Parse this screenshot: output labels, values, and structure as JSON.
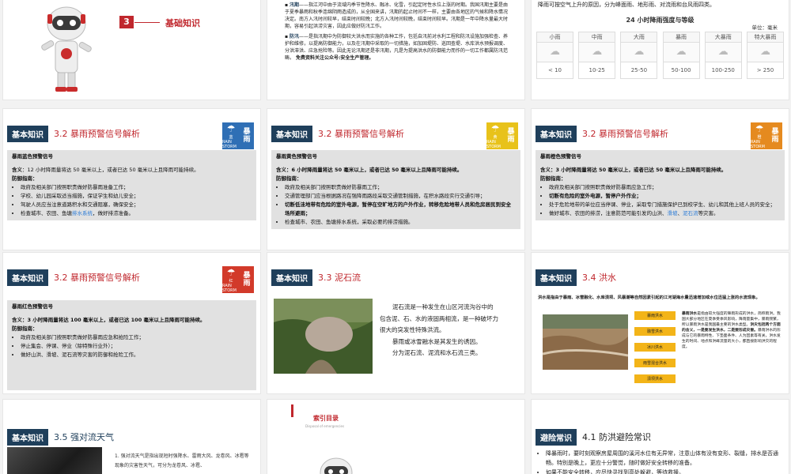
{
  "slide1": {
    "num": "3",
    "title": "基础知识"
  },
  "slide2": {
    "p1_head": "汛期",
    "p1_text": "——指江河中由于流域内季节性降水、融冰、化雪，引起定时性水位上涨的时期。我国汛期主要是由于夏季暴雨和秋季连绵阴雨造成的，从全国来讲，汛期的起止时间不一样，主要由各地区的气候和降水情况决定。南方入汛时间较早，结束时间较晚；北方入汛时间较晚，结束时间较早。汛期是一年中降水量最大时期，容易引起洪涝灾害，因此应做好防汛工作。",
    "p2_head": "防汛",
    "p2_text": "——是指汛期中为防御较大洪水而实施的各种工作，包括自汛前对水利工程和防汛设施加强检查、养护和维修，以提高防御能力，以及在汛期中采取的一切措施，如加固堤防、巡回查堤、水库洪水预报调度、分洪滞洪、应急抢险等。因此无论汛期还是非汛期，凡是为提高洪水的防御能力而作的一切工作都属防汛范畴。",
    "p2_end": "免费资料关注公众号:安全生产管理。"
  },
  "slide3": {
    "intro": "降雨可按空气上升的原因，分为峰面雨、地形雨、对流雨和台风雨四类。",
    "table_title": "24 小时降雨强度与等级",
    "unit": "单位：毫米",
    "headers": [
      "小雨",
      "中雨",
      "大雨",
      "暴雨",
      "大暴雨",
      "特大暴雨"
    ],
    "values": [
      "< 10",
      "10-25",
      "25-50",
      "50-100",
      "100-250",
      "> 250"
    ]
  },
  "slide4": {
    "tag": "基本知识",
    "title": "3.2  暴雨预警信号解析",
    "badge_line1": "暴",
    "badge_line2": "雨",
    "badge_small": "蓝",
    "badge_rs": "RAIN STORM",
    "badge_color": "#2f6fb5",
    "box_title": "暴雨蓝色预警信号",
    "meaning_label": "含义",
    "meaning": "：12 小时降雨量将达 50 毫米以上，或者已达 50 毫米以上且降雨可能持续。",
    "guide": "防御指南：",
    "items": [
      "政府及相关部门按照职责做好防暴雨准备工作；",
      "学校、幼儿园采取适当措施，保证学生和幼儿安全；",
      "驾驶人员应当注意道路积水和交通阻塞，确保安全；"
    ],
    "item4_pre": "检查城市、农田、鱼塘",
    "item4_blue": "排水系统",
    "item4_post": "，做好排涝准备。"
  },
  "slide5": {
    "tag": "基本知识",
    "title": "3.2  暴雨预警信号解析",
    "badge_line1": "暴",
    "badge_line2": "雨",
    "badge_small": "黄",
    "badge_rs": "RAIN STORM",
    "badge_color": "#e8c21a",
    "box_title": "暴雨黄色预警信号",
    "meaning_label": "含义",
    "meaning": "：6 小时降雨量将达 50 毫米以上，或者已达 50 毫米以上且降雨可能持续。",
    "guide": "防御指南：",
    "items": [
      "政府及相关部门按照职责做好防暴雨工作；",
      "交通管理部门应当根据路况在强降雨路段采取交通管制措施，在积水路段实行交通引导；"
    ],
    "item_bold": "切断低洼地带有危险的室外电源，暂停在空旷地方的户外作业，转移危险地带人员和危房居民到安全场所避雨；",
    "item_last": "检查城市、农田、鱼塘排水系统，采取必要的排涝措施。"
  },
  "slide6": {
    "tag": "基本知识",
    "title": "3.2  暴雨预警信号解析",
    "badge_line1": "暴",
    "badge_line2": "雨",
    "badge_small": "橙",
    "badge_rs": "RAIN STORM",
    "badge_color": "#e58a1f",
    "box_title": "暴雨橙色预警信号",
    "meaning_label": "含义",
    "meaning": "：3 小时降雨量将达 50 毫米以上，或者已达 50 毫米以上且降雨可能持续。",
    "guide": "防御指南：",
    "item1": "政府及相关部门按照职责做好防暴雨应急工作；",
    "item2": "切断有危险的室外电源，暂停户外作业；",
    "item3": "处于危险地带的单位应当停课、停业，采取专门措施保护已到校学生、幼儿和其他上班人员的安全；",
    "item4_pre": "做好城市、农田的排涝，注意防范可能引发的山洪、",
    "item4_b1": "滑坡",
    "item4_mid": "、",
    "item4_b2": "泥石流",
    "item4_post": "等灾害。"
  },
  "slide7": {
    "tag": "基本知识",
    "title": "3.2  暴雨预警信号解析",
    "badge_line1": "暴",
    "badge_line2": "雨",
    "badge_small": "红",
    "badge_rs": "RAIN STORM",
    "badge_color": "#d23a2a",
    "box_title": "暴雨红色预警信号",
    "meaning_label": "含义",
    "meaning": "：3 小时降雨量将达 100 毫米以上，或者已达 100 毫米以上且降雨可能持续。",
    "guide": "防御指南：",
    "items": [
      "政府及相关部门按照职责做好防暴雨应急和抢险工作；",
      "停止集会、停课、停业（除特殊行业外）；",
      "做好山洪、滑坡、泥石流等灾害的防御和抢险工作。"
    ]
  },
  "slide8": {
    "tag": "基本知识",
    "title": "3.3  泥石流",
    "lines": [
      "泥石流是一种发生在山区河流沟谷中的",
      "包含泥、石、水的液固两相流，是一种破坏力",
      "很大的突发性特殊洪流。",
      "暴雨或冰雪融水是其发生的诱因。",
      "分为泥石流、泥流和水石流三类。"
    ]
  },
  "slide9": {
    "tag": "基本知识",
    "title": "3.4  洪水",
    "intro": "洪水是指由于暴雨、冰雪融化、水库溃坝、风暴潮等自然因素引起的江河湖海水量迅速增加或水位迅猛上涨的水流现象。",
    "labels": [
      "暴雨洪水",
      "融雪洪水",
      "冰川洪水",
      "雨雪混合洪水",
      "溃坝洪水"
    ],
    "desc_head": "暴雨洪水",
    "desc1": "是指由较大强度的降雨形成的洪水，简称雨洪。我国大部分地区在夏季受季风影响，降雨量集中，暴雨频繁，所以暴雨洪水是我国最主要的洪水类型。",
    "desc_bold": "洪灾包括两个方面的含义，一是要发生洪水，二是要形成灾害。",
    "desc2": "暴雨洪水的形成与它的暴雨特性、下垫面条件、人为因素等有关，洪水发生的时间、地点和洪峰流量的大小，都直接影响洪灾的程度。"
  },
  "slide10": {
    "tag": "基本知识",
    "title": "3.5  强对流天气",
    "text": "1. 强对流天气是指出现短时强降水、雷雨大风、龙卷风、冰雹等现象的灾害性天气，可分为龙卷风、冰雹、"
  },
  "slide11": {
    "title": "索引目录",
    "subtitle": "Disposal of emergencies"
  },
  "slide12": {
    "tag": "避险常识",
    "title": "4.1  防洪避险常识",
    "item1": "降暴雨时，要时刻观察房屋周围的溪河水位有无异常，注意山体有没有变形、裂缝，排水是否通畅。特别是晚上，更应十分警觉，随时做好安全转移的准备。",
    "item2": "如果不能安全转移，应尽快寻找到高处躲避，等待救援。"
  }
}
